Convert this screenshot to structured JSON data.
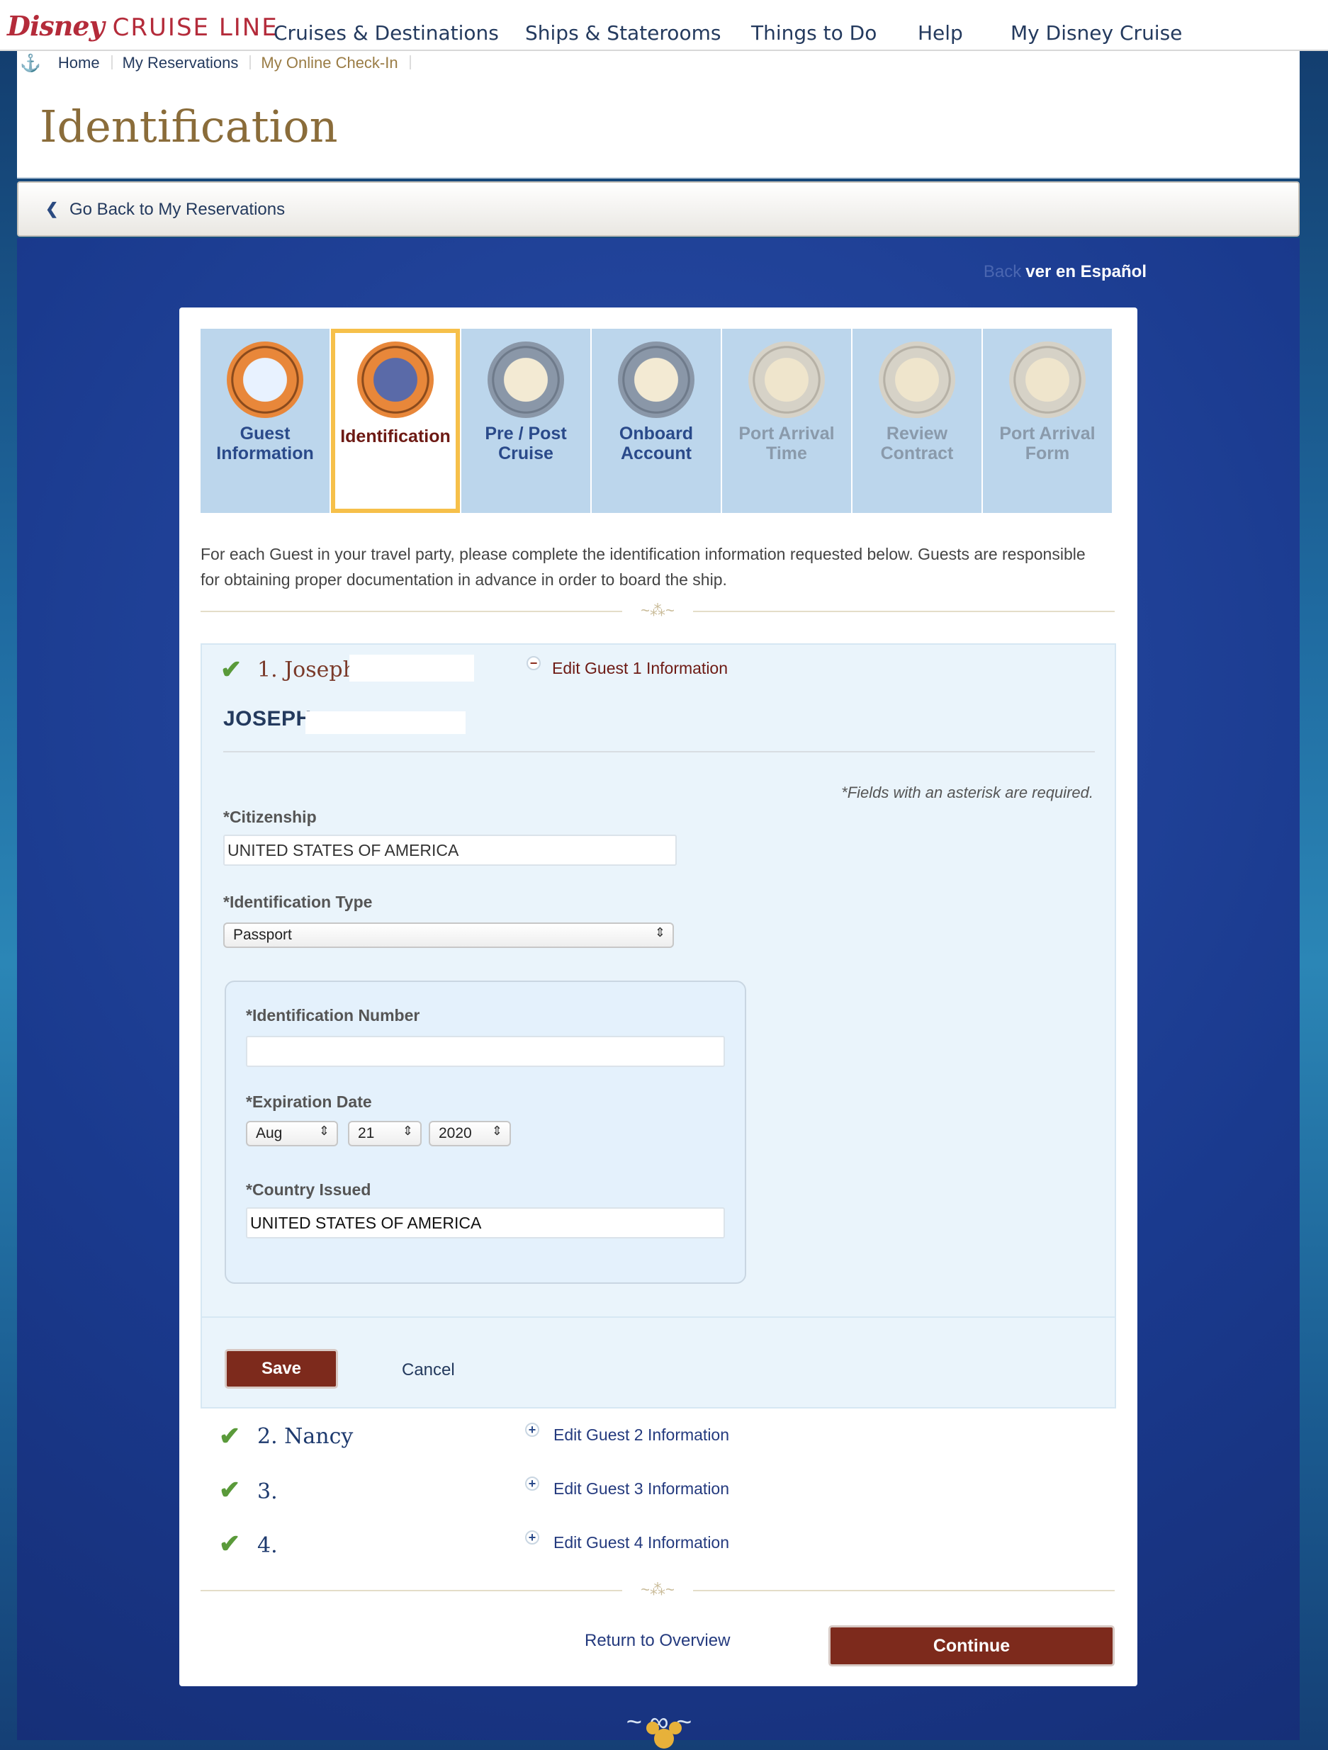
{
  "brand": {
    "disney": "Disney",
    "cruise_line": "CRUISE LINE"
  },
  "nav": [
    "Cruises & Destinations",
    "Ships & Staterooms",
    "Things to Do",
    "Help",
    "My Disney Cruise"
  ],
  "breadcrumb": [
    "Home",
    "My Reservations",
    "My Online Check-In"
  ],
  "page_title": "Identification",
  "back_link": "Go Back to My Reservations",
  "language": {
    "faded": "Back",
    "link": "ver en Español"
  },
  "steps": [
    {
      "line1": "Guest",
      "line2": "Information",
      "state": "done"
    },
    {
      "line1": "Identification",
      "line2": "",
      "state": "current"
    },
    {
      "line1": "Pre / Post",
      "line2": "Cruise",
      "state": "next"
    },
    {
      "line1": "Onboard",
      "line2": "Account",
      "state": "next"
    },
    {
      "line1": "Port Arrival",
      "line2": "Time",
      "state": "disabled"
    },
    {
      "line1": "Review",
      "line2": "Contract",
      "state": "disabled"
    },
    {
      "line1": "Port Arrival",
      "line2": "Form",
      "state": "disabled"
    }
  ],
  "intro": "For each Guest in your travel party, please complete the identification information requested below. Guests are responsible for obtaining proper documentation in advance in order to board the ship.",
  "guests": [
    {
      "name": "1. Joseph",
      "edit": "Edit Guest 1 Information",
      "full_name": "JOSEPH"
    },
    {
      "name": "2. Nancy",
      "edit": "Edit Guest 2 Information"
    },
    {
      "name": "3.",
      "edit": "Edit Guest 3 Information"
    },
    {
      "name": "4.",
      "edit": "Edit Guest 4 Information"
    }
  ],
  "form": {
    "required_note": "*Fields with an asterisk are required.",
    "citizenship_label": "*Citizenship",
    "citizenship_value": "UNITED STATES OF AMERICA",
    "id_type_label": "*Identification Type",
    "id_type_value": "Passport",
    "id_number_label": "*Identification Number",
    "id_number_value": "",
    "expiration_label": "*Expiration Date",
    "exp_month": "Aug",
    "exp_day": "21",
    "exp_year": "2020",
    "country_label": "*Country Issued",
    "country_value": "UNITED STATES OF AMERICA",
    "save": "Save",
    "cancel": "Cancel"
  },
  "footer": {
    "return": "Return to Overview",
    "continue": "Continue"
  },
  "colors": {
    "primary_button": "#7d2a1c",
    "step_highlight": "#f6c04a",
    "link": "#243a7e",
    "check": "#5a9a3a"
  }
}
